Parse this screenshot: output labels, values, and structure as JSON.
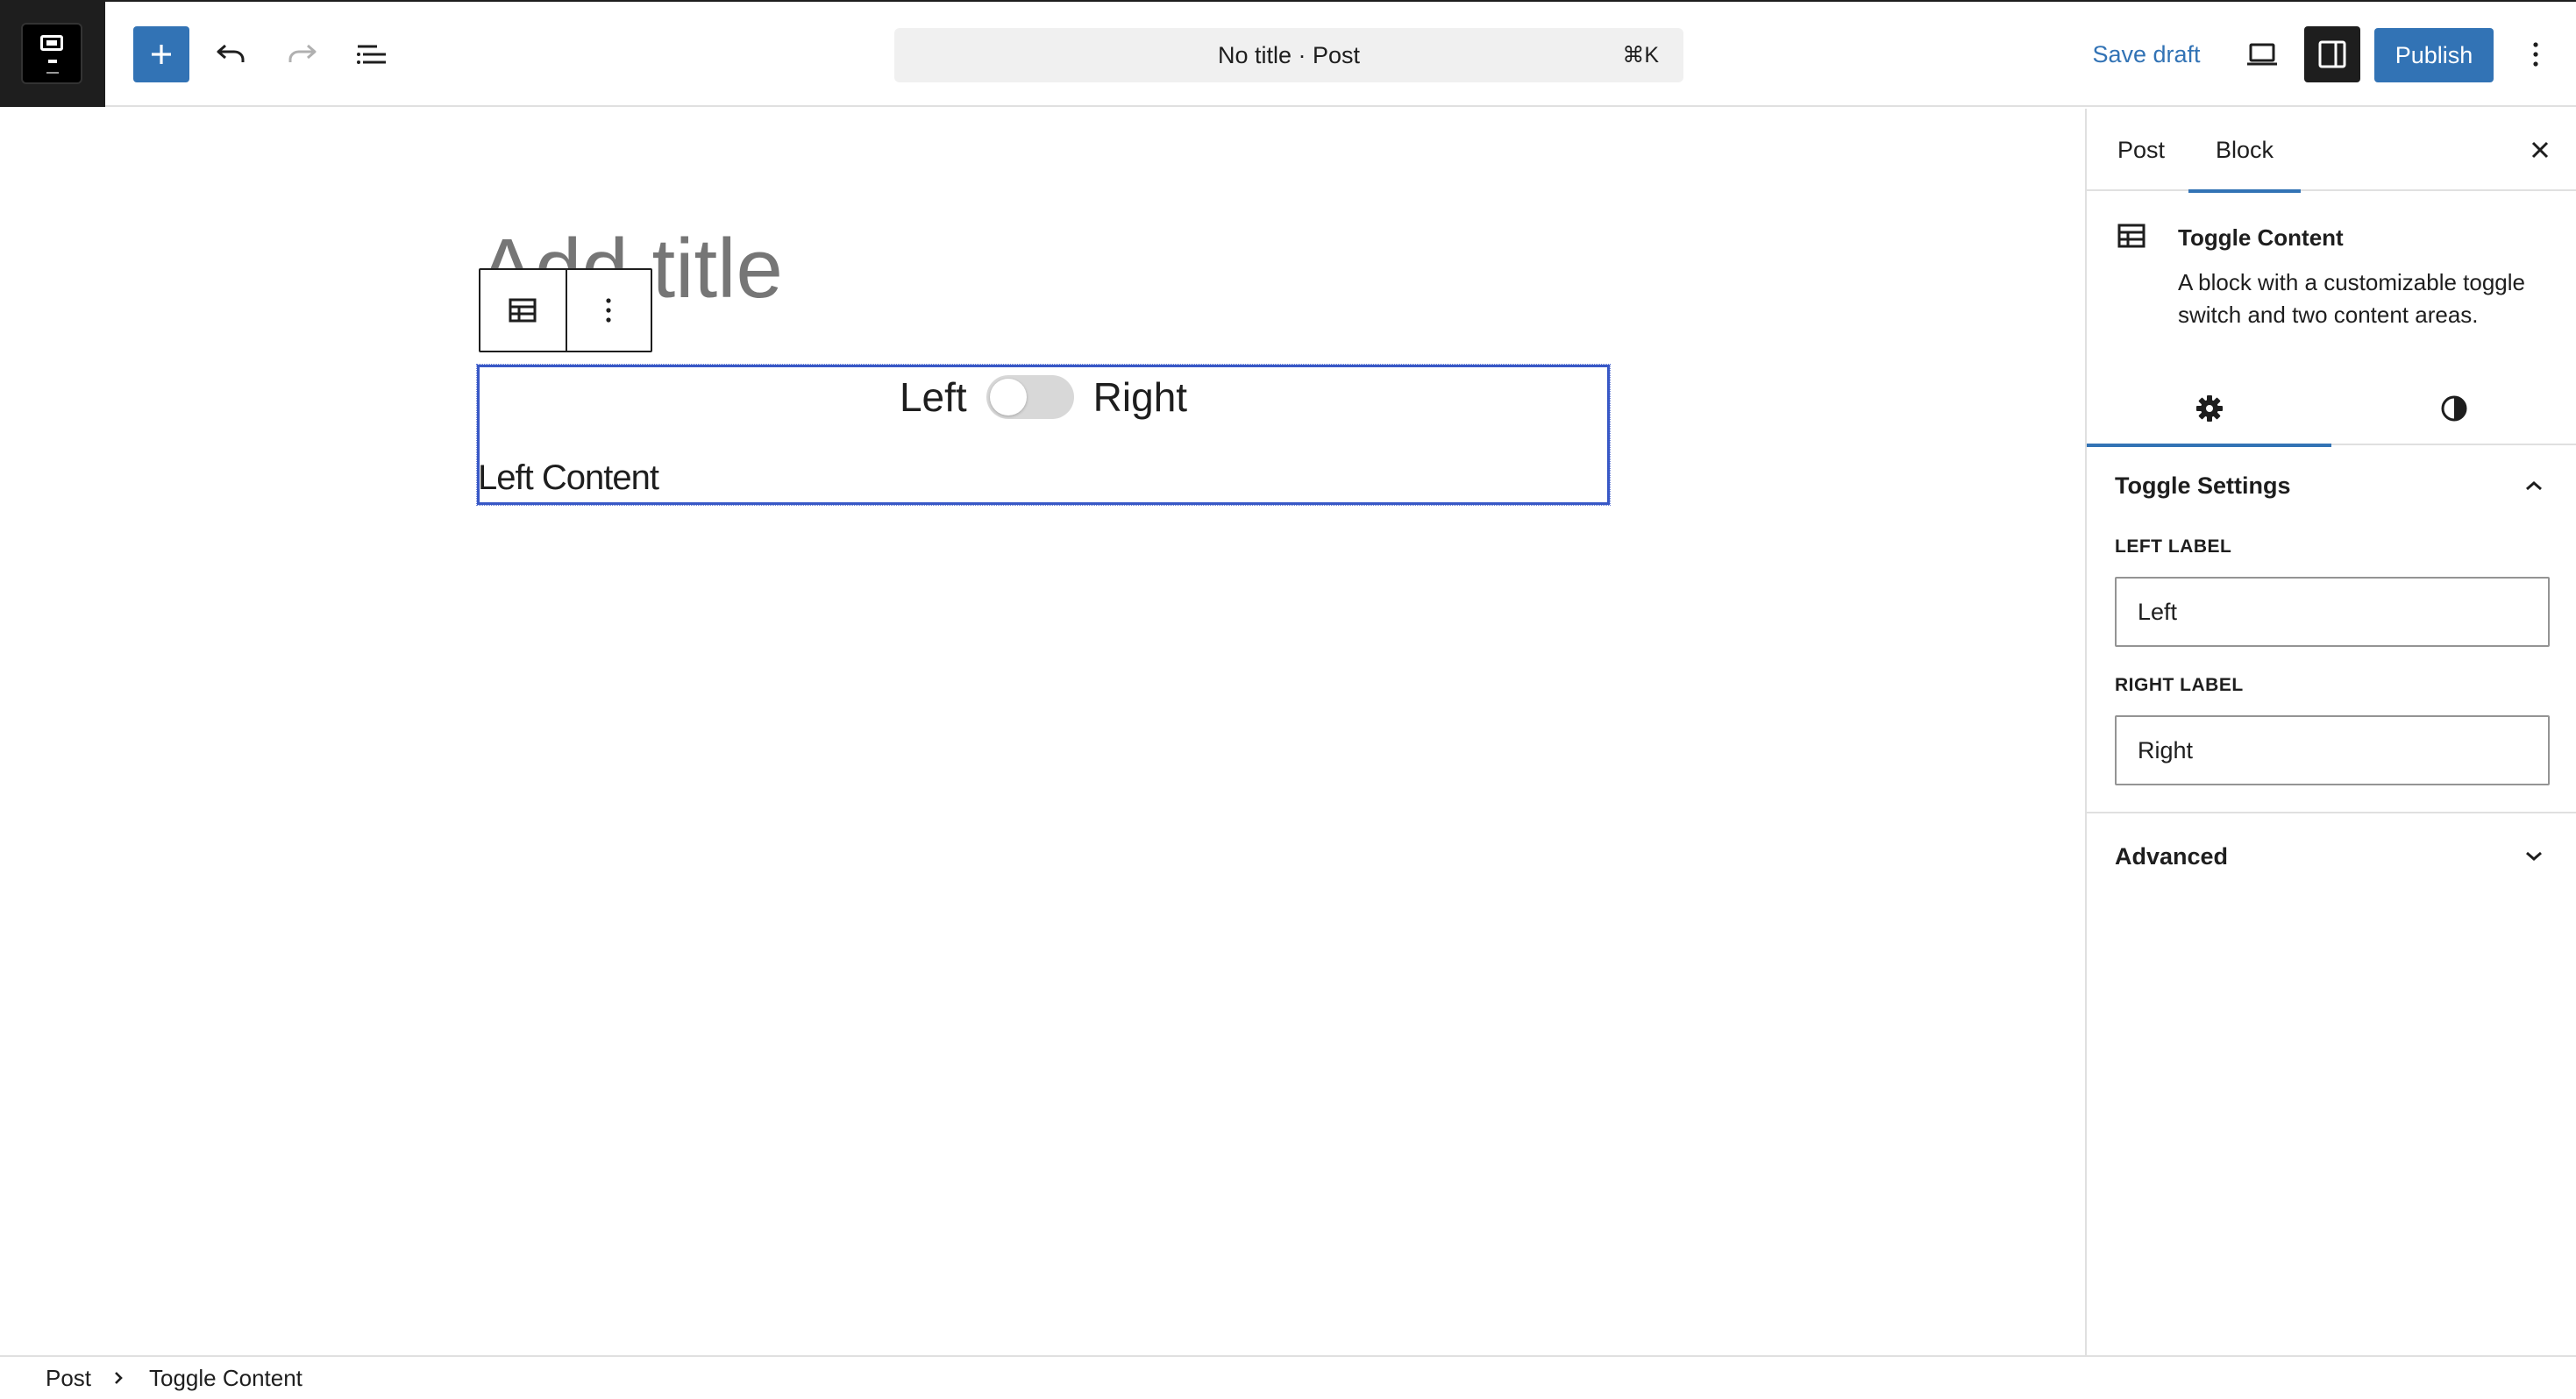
{
  "toolbar": {
    "command_title": "No title · Post",
    "command_shortcut": "⌘K",
    "save_draft": "Save draft",
    "publish": "Publish"
  },
  "editor": {
    "title_placeholder": "Add title",
    "toggle_block": {
      "left_label": "Left",
      "right_label": "Right",
      "content": "Left Content"
    }
  },
  "sidebar": {
    "tabs": [
      "Post",
      "Block"
    ],
    "block_card": {
      "title": "Toggle Content",
      "description": "A block with a customizable toggle switch and two content areas."
    },
    "toggle_settings": {
      "title": "Toggle Settings",
      "left_label_heading": "LEFT LABEL",
      "left_label_value": "Left",
      "right_label_heading": "RIGHT LABEL",
      "right_label_value": "Right"
    },
    "advanced": "Advanced"
  },
  "breadcrumb": [
    "Post",
    "Toggle Content"
  ],
  "colors": {
    "accent": "#3273b5",
    "selection": "#3858c6",
    "dark": "#1e1e1e"
  }
}
